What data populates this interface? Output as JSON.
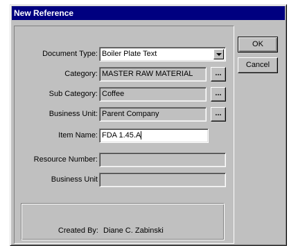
{
  "window": {
    "title": "New Reference"
  },
  "form": {
    "document_type": {
      "label": "Document Type:",
      "value": "Boiler Plate Text"
    },
    "category": {
      "label": "Category:",
      "value": "MASTER RAW MATERIAL"
    },
    "sub_category": {
      "label": "Sub Category:",
      "value": "Coffee"
    },
    "business_unit": {
      "label": "Business Unit:",
      "value": "Parent Company"
    },
    "item_name": {
      "label": "Item Name:",
      "value": "FDA 1.45.A"
    },
    "resource_number": {
      "label": "Resource Number:",
      "value": ""
    },
    "business_unit_2": {
      "label": "Business Unit",
      "value": ""
    },
    "created_by": {
      "label": "Created By:",
      "value": "Diane C. Zabinski"
    }
  },
  "buttons": {
    "ok": "OK",
    "cancel": "Cancel",
    "ellipsis": "..."
  },
  "colors": {
    "face": "#c0c0c0",
    "titlebar": "#000080"
  }
}
